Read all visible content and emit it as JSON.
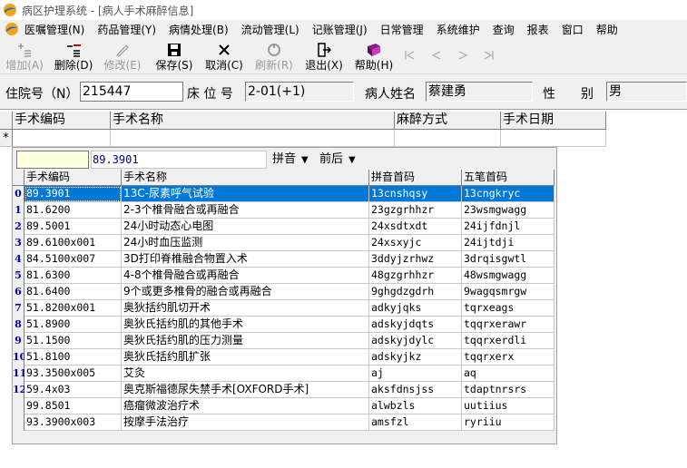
{
  "window": {
    "title": "病区护理系统 - [病人手术麻醉信息]"
  },
  "menu": [
    "医嘱管理(N)",
    "药品管理(Y)",
    "病情处理(B)",
    "流动管理(L)",
    "记账管理(J)",
    "日常管理",
    "系统维护",
    "查询",
    "报表",
    "窗口",
    "帮助"
  ],
  "toolbar": {
    "add": "增加(A)",
    "delete": "删除(D)",
    "modify": "修改(E)",
    "save": "保存(S)",
    "cancel": "取消(C)",
    "refresh": "刷新(R)",
    "exit": "退出(X)",
    "help": "帮助(H)"
  },
  "patient": {
    "admission_label": "住院号（N）",
    "admission_no": "215447",
    "bed_label": "床 位 号",
    "bed_no": "2-01(+1)",
    "name_label": "病人姓名",
    "name": "蔡建勇",
    "gender_label": "性　　别",
    "gender": "男"
  },
  "main_grid": {
    "headers": [
      "手术编码",
      "手术名称",
      "麻醉方式",
      "手术日期"
    ],
    "new_row_marker": "*"
  },
  "popup": {
    "search_value": "",
    "code_value": "89.3901",
    "pinyin_dropdown": "拼音",
    "match_dropdown": "前后",
    "headers": [
      "手术编码",
      "手术名称",
      "拼音首码",
      "五笔首码"
    ],
    "rows": [
      {
        "num": "0",
        "code": "89.3901",
        "name": "13C-尿素呼气试验",
        "pinyin": "13cnshqsy",
        "wubi": "13cngkryc"
      },
      {
        "num": "1",
        "code": "81.6200",
        "name": "2-3个椎骨融合或再融合",
        "pinyin": "23gzgrhhzr",
        "wubi": "23wsmgwagg"
      },
      {
        "num": "2",
        "code": "89.5001",
        "name": "24小时动态心电图",
        "pinyin": "24xsdtxdt",
        "wubi": "24ijfdnjl"
      },
      {
        "num": "3",
        "code": "89.6100x001",
        "name": "24小时血压监测",
        "pinyin": "24xsxyjc",
        "wubi": "24ijtdji"
      },
      {
        "num": "4",
        "code": "84.5100x007",
        "name": "3D打印脊椎融合物置入术",
        "pinyin": "3ddyjzrhwz",
        "wubi": "3drqisgwtl"
      },
      {
        "num": "5",
        "code": "81.6300",
        "name": "4-8个椎骨融合或再融合",
        "pinyin": "48gzgrhhzr",
        "wubi": "48wsmgwagg"
      },
      {
        "num": "6",
        "code": "81.6400",
        "name": "9个或更多椎骨的融合或再融合",
        "pinyin": "9ghgdzgdrh",
        "wubi": "9wagqsmrgw"
      },
      {
        "num": "7",
        "code": "51.8200x001",
        "name": "奥狄括约肌切开术",
        "pinyin": "adkyjqks",
        "wubi": "tqrxeags"
      },
      {
        "num": "8",
        "code": "51.8900",
        "name": "奥狄氏括约肌的其他手术",
        "pinyin": "adskyjdqts",
        "wubi": "tqqrxerawr"
      },
      {
        "num": "9",
        "code": "51.1500",
        "name": "奥狄氏括约肌的压力测量",
        "pinyin": "adskyjdylc",
        "wubi": "tqqrxerdli"
      },
      {
        "num": "10",
        "code": "51.8100",
        "name": "奥狄氏括约肌扩张",
        "pinyin": "adskyjkz",
        "wubi": "tqqrxerx"
      },
      {
        "num": "11",
        "code": "93.3500x005",
        "name": "艾灸",
        "pinyin": "aj",
        "wubi": "aq"
      },
      {
        "num": "12",
        "code": "59.4x03",
        "name": "奥克斯福德尿失禁手术[OXFORD手术]",
        "pinyin": "aksfdnsjss",
        "wubi": "tdaptnrsrs"
      },
      {
        "num": "",
        "code": "99.8501",
        "name": "癌瘤微波治疗术",
        "pinyin": "alwbzls",
        "wubi": "uutiius"
      },
      {
        "num": "",
        "code": "93.3900x003",
        "name": "按摩手法治疗",
        "pinyin": "amsfzl",
        "wubi": "ryriiu"
      }
    ]
  },
  "colors": {
    "selection": "#0078d7",
    "row_number": "#0000c0",
    "window_bg": "#f0f0f0"
  },
  "icons": [
    "app-logo-icon",
    "mdi-child-icon",
    "add-icon",
    "delete-icon",
    "modify-icon",
    "save-icon",
    "cancel-x-icon",
    "refresh-icon",
    "exit-icon",
    "help-book-icon",
    "first-icon",
    "prev-icon",
    "next-icon",
    "last-icon",
    "dropdown-arrow-icon"
  ]
}
